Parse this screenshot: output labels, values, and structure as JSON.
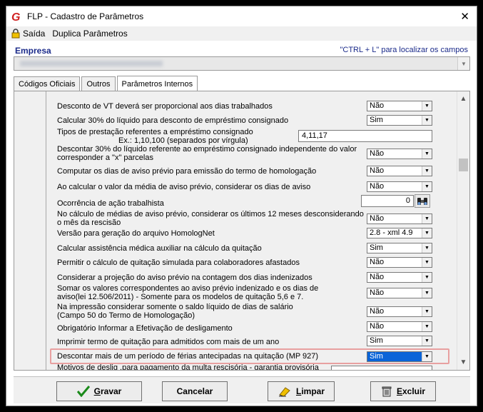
{
  "window": {
    "title": "FLP - Cadastro de Parâmetros",
    "close": "✕"
  },
  "menu": {
    "exit": "Saída",
    "duplicate": "Duplica Parâmetros"
  },
  "empresa": {
    "label": "Empresa",
    "hint": "\"CTRL + L\" para localizar os campos"
  },
  "tabs": [
    {
      "label": "Códigos Oficiais"
    },
    {
      "label": "Outros"
    },
    {
      "label": "Parâmetros Internos"
    }
  ],
  "rows": [
    {
      "label": "Desconto de VT deverá ser proporcional aos dias trabalhados",
      "value": "Não"
    },
    {
      "label": "Calcular 30% do líquido para desconto de empréstimo consignado",
      "value": "Sim"
    },
    {
      "label": "Tipos de prestação referentes a empréstimo consignado",
      "sublabel": "Ex.: 1,10,100 (separados por vírgula)",
      "value": "4,11,17"
    },
    {
      "label": "Descontar 30% do líquido referente ao empréstimo consignado independente do valor",
      "label2": "corresponder a \"x\" parcelas",
      "value": "Não"
    },
    {
      "label": "Computar os dias de aviso prévio para emissão do termo de homologação",
      "value": "Não"
    },
    {
      "label": "Ao calcular o valor da média de aviso prévio, considerar os dias de aviso",
      "value": "Não"
    },
    {
      "label": "Ocorrência de ação trabalhista",
      "value": "0"
    },
    {
      "label": "No cálculo de médias de aviso prévio, considerar os últimos 12 meses desconsiderando",
      "label2": "o mês da rescisão",
      "value": "Não"
    },
    {
      "label": "Versão para geração do arquivo HomologNet",
      "value": "2.8 - xml 4.9"
    },
    {
      "label": "Calcular assistência médica auxiliar na cálculo da quitação",
      "value": "Sim"
    },
    {
      "label": "Permitir o cálculo de quitação simulada para colaboradores afastados",
      "value": "Não"
    },
    {
      "label": "Considerar a projeção do aviso prévio na contagem dos dias indenizados",
      "value": "Não"
    },
    {
      "label": "Somar os valores correspondentes ao aviso prévio indenizado e os dias de",
      "label2": "aviso(lei 12.506/2011)  - Somente para os modelos de quitação 5,6 e 7.",
      "value": "Não"
    },
    {
      "label": "Na impressão considerar somente o saldo líquido de dias de salário",
      "label2": "(Campo 50 do Termo de Homologação)",
      "value": "Não"
    },
    {
      "label": "Obrigatório Informar a Efetivação de desligamento",
      "value": "Não"
    },
    {
      "label": "Imprimir termo de quitação para admitidos com mais de um ano",
      "value": "Sim"
    },
    {
      "label": "Descontar mais de um período de férias antecipadas na quitação (MP 927)",
      "value": "Sim"
    },
    {
      "label": "Motivos de deslig .para pagamento da multa rescisória - garantia provisória"
    }
  ],
  "buttons": {
    "save_u": "G",
    "save_rest": "ravar",
    "cancel": "Cancelar",
    "clear_u": "L",
    "clear_rest": "impar",
    "delete_u": "E",
    "delete_rest": "xcluir"
  },
  "icons": [
    "g-app-icon",
    "lock-icon",
    "binoculars-icon",
    "checkmark-icon",
    "eraser-icon",
    "trash-icon",
    "chevron-down-icon",
    "scroll-up-icon",
    "scroll-down-icon"
  ],
  "colors": {
    "brand_red": "#d02020",
    "header_blue": "#1b2b8a",
    "selection_blue": "#0a64d8",
    "highlight_outline": "#e8a0a0"
  }
}
